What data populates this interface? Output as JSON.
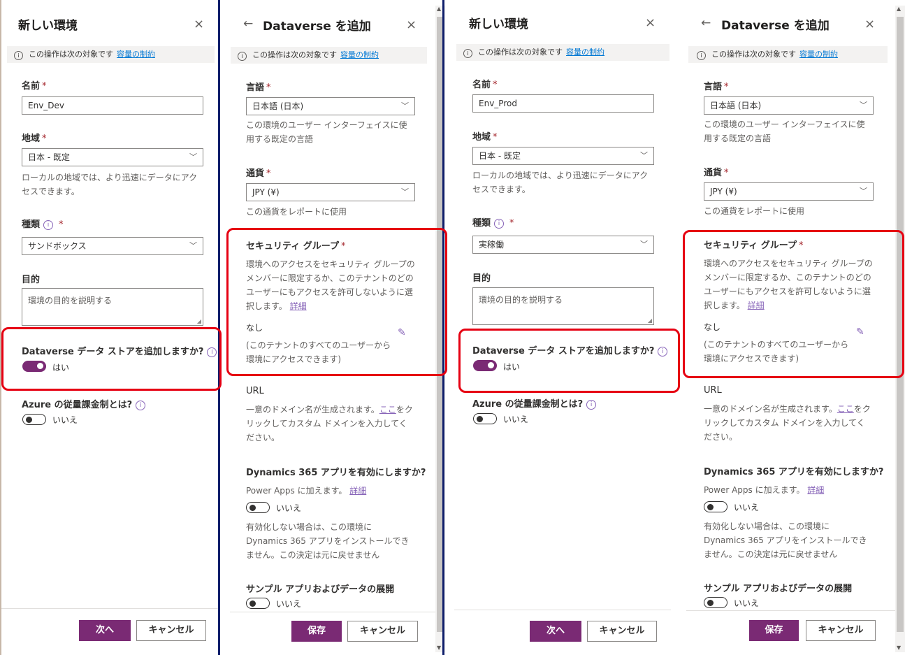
{
  "new_env": {
    "title": "新しい環境",
    "close_glyph": "×",
    "info_text": "この操作は次の対象です",
    "info_link": "容量の制約",
    "name_label": "名前",
    "region_label": "地域",
    "region_value": "日本 - 既定",
    "region_help": "ローカルの地域では、より迅速にデータにアクセスできます。",
    "type_label": "種類",
    "purpose_label": "目的",
    "purpose_placeholder": "環境の目的を説明する",
    "dataverse_question": "Dataverse データ ストアを追加しますか?",
    "dataverse_value": "はい",
    "azure_question": "Azure の従量課金制とは?",
    "azure_value": "いいえ",
    "next_button": "次へ",
    "cancel_button": "キャンセル"
  },
  "panel1": {
    "name_value": "Env_Dev",
    "type_value": "サンドボックス"
  },
  "panel3": {
    "name_value": "Env_Prod",
    "type_value": "実稼働"
  },
  "add_dv": {
    "title": "Dataverse を追加",
    "back_glyph": "←",
    "close_glyph": "×",
    "info_text": "この操作は次の対象です",
    "info_link": "容量の制約",
    "language_label": "言語",
    "language_value": "日本語 (日本)",
    "language_help": "この環境のユーザー インターフェイスに使用する既定の言語",
    "currency_label": "通貨",
    "currency_value": "JPY (¥)",
    "currency_help": "この通貨をレポートに使用",
    "security_label": "セキュリティ グループ",
    "security_help": "環境へのアクセスをセキュリティ グループのメンバーに限定するか、このテナントのどのユーザーにもアクセスを許可しないように選択します。",
    "security_link": "詳細",
    "security_value": "なし",
    "security_note": "(このテナントのすべてのユーザーから環境にアクセスできます)",
    "url_label": "URL",
    "url_help": "一意のドメイン名が生成されます。",
    "url_link": "ここ",
    "url_help2": "をクリックしてカスタム ドメインを入力してください。",
    "d365_label": "Dynamics 365 アプリを有効にしますか?",
    "d365_help": "Power Apps に加えます。",
    "d365_link": "詳細",
    "d365_value": "いいえ",
    "d365_note": "有効化しない場合は、この環境に Dynamics 365 アプリをインストールできません。この決定は元に戻せません",
    "sample_label": "サンプル アプリおよびデータの展開",
    "sample_value": "いいえ",
    "save_button": "保存",
    "cancel_button": "キャンセル"
  },
  "icons": {
    "info": "i",
    "chevron": "﹀",
    "pencil": "✎",
    "required": "*"
  },
  "colors": {
    "accent": "#7a2a74",
    "highlight": "#e60012",
    "link_blue": "#0078d4"
  }
}
